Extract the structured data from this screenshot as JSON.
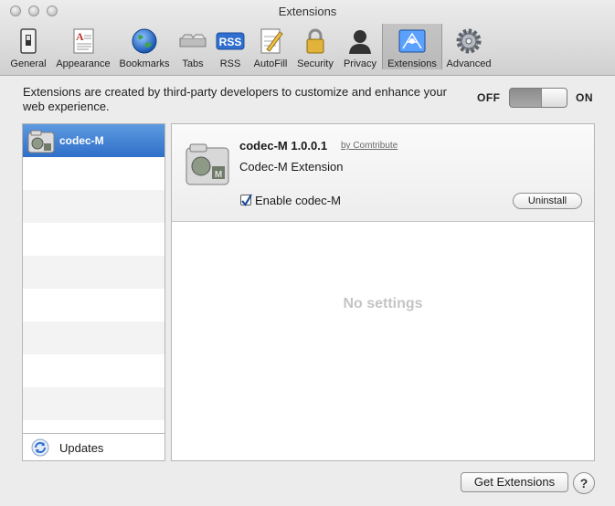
{
  "window": {
    "title": "Extensions"
  },
  "toolbar": {
    "items": [
      {
        "label": "General",
        "icon": "switch-icon"
      },
      {
        "label": "Appearance",
        "icon": "font-document-icon"
      },
      {
        "label": "Bookmarks",
        "icon": "globe-icon"
      },
      {
        "label": "Tabs",
        "icon": "tabs-icon"
      },
      {
        "label": "RSS",
        "icon": "rss-icon"
      },
      {
        "label": "AutoFill",
        "icon": "pencil-form-icon"
      },
      {
        "label": "Security",
        "icon": "lock-icon"
      },
      {
        "label": "Privacy",
        "icon": "person-silhouette-icon"
      },
      {
        "label": "Extensions",
        "icon": "extensions-icon",
        "selected": true
      },
      {
        "label": "Advanced",
        "icon": "gear-icon"
      }
    ]
  },
  "intro": {
    "text": "Extensions are created by third-party developers to customize and enhance your web experience."
  },
  "switch": {
    "off_label": "OFF",
    "on_label": "ON",
    "state": "on"
  },
  "sidebar": {
    "items": [
      {
        "label": "codec-M",
        "selected": true
      }
    ],
    "updates_label": "Updates"
  },
  "detail": {
    "name": "codec-M 1.0.0.1",
    "by": "by Comtribute",
    "description": "Codec-M Extension",
    "enable_label": "Enable codec-M",
    "enabled": true,
    "uninstall_label": "Uninstall",
    "no_settings": "No settings"
  },
  "footer": {
    "get_extensions_label": "Get Extensions",
    "help_label": "?"
  },
  "colors": {
    "selection": "#3a7bd5",
    "window_bg": "#ececec"
  }
}
